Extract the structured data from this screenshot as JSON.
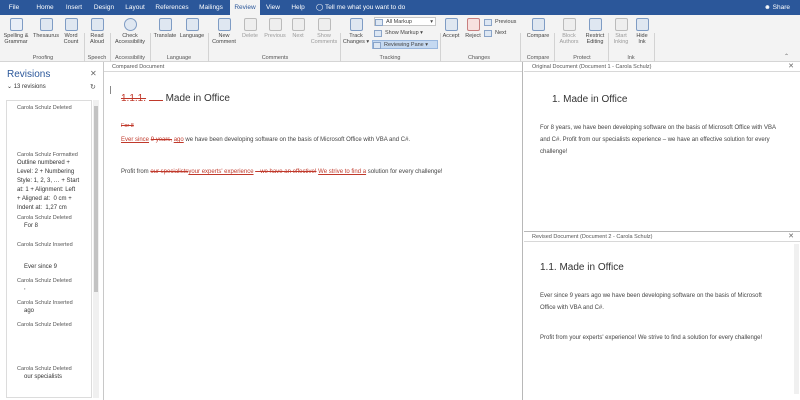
{
  "tabs": [
    "File",
    "Home",
    "Insert",
    "Design",
    "Layout",
    "References",
    "Mailings",
    "Review",
    "View",
    "Help"
  ],
  "active_tab": "Review",
  "tell_me": "Tell me what you want to do",
  "share": "Share",
  "ribbon": {
    "spelling": "Spelling & Grammar",
    "thesaurus": "Thesaurus",
    "word_count": "Word Count",
    "read_aloud": "Read Aloud",
    "check_accessibility": "Check Accessibility",
    "translate": "Translate",
    "language": "Language",
    "new_comment": "New Comment",
    "delete": "Delete",
    "previous_comment": "Previous",
    "next_comment": "Next",
    "show_comments": "Show Comments",
    "track_changes": "Track Changes",
    "all_markup": "All Markup",
    "show_markup": "Show Markup",
    "reviewing_pane": "Reviewing Pane",
    "accept": "Accept",
    "reject": "Reject",
    "previous": "Previous",
    "next": "Next",
    "compare": "Compare",
    "block_authors": "Block Authors",
    "restrict_editing": "Restrict Editing",
    "start_inking": "Start Inking",
    "hide_ink": "Hide Ink",
    "groups": [
      "Proofing",
      "Speech",
      "Accessibility",
      "Language",
      "Comments",
      "Tracking",
      "Changes",
      "Compare",
      "Protect",
      "Ink"
    ]
  },
  "revisions": {
    "title": "Revisions",
    "count": "13 revisions",
    "items": [
      {
        "header": "Carola Schulz Deleted",
        "text": ""
      },
      {
        "header": "Carola Schulz Formatted",
        "text": "Outline numbered +\nLevel: 2 + Numbering\nStyle: 1, 2, 3, … + Start\nat: 1 + Alignment: Left\n+ Aligned at:  0 cm +\nIndent at:  1,27 cm"
      },
      {
        "header": "Carola Schulz Deleted",
        "text": "For 8"
      },
      {
        "header": "Carola Schulz Inserted",
        "text": "Ever since 9"
      },
      {
        "header": "Carola Schulz Deleted",
        "text": ","
      },
      {
        "header": "Carola Schulz Inserted",
        "text": "ago"
      },
      {
        "header": "Carola Schulz Deleted",
        "text": ""
      },
      {
        "header": "Carola Schulz Deleted",
        "text": "our specialists"
      }
    ]
  },
  "compared": {
    "title": "Compared Document",
    "heading_num": "1.1.1.",
    "heading": "Made in Office",
    "del_for8": "For 8",
    "p1_ins": "Ever since",
    "p1_a": "9 years,",
    "p1_ins2": "ago",
    "p1_b": "we have been developing software on the basis of Microsoft Office with VBA and C#.",
    "p2_a": "Profit from",
    "p2_del": "our specialists",
    "p2_ins": "your experts' experience",
    "p2_b": "– we have an effective!",
    "p2_c": "We strive to find a",
    "p2_d": "solution for every challenge!"
  },
  "original": {
    "title": "Original Document (Document 1 - Carola Schulz)",
    "heading": "1.   Made in Office",
    "p1": "For 8 years, we have been developing software on the basis of Microsoft Office with VBA and C#. Profit from our specialists experience – we have an effective solution for every challenge!"
  },
  "revised": {
    "title": "Revised Document (Document 2 - Carola Schulz)",
    "heading": "1.1.   Made in Office",
    "p1": "Ever since 9 years ago we have been developing software on the basis of Microsoft Office with VBA and C#.",
    "p2": "Profit from your experts' experience! We strive to find a solution for every challenge!"
  }
}
